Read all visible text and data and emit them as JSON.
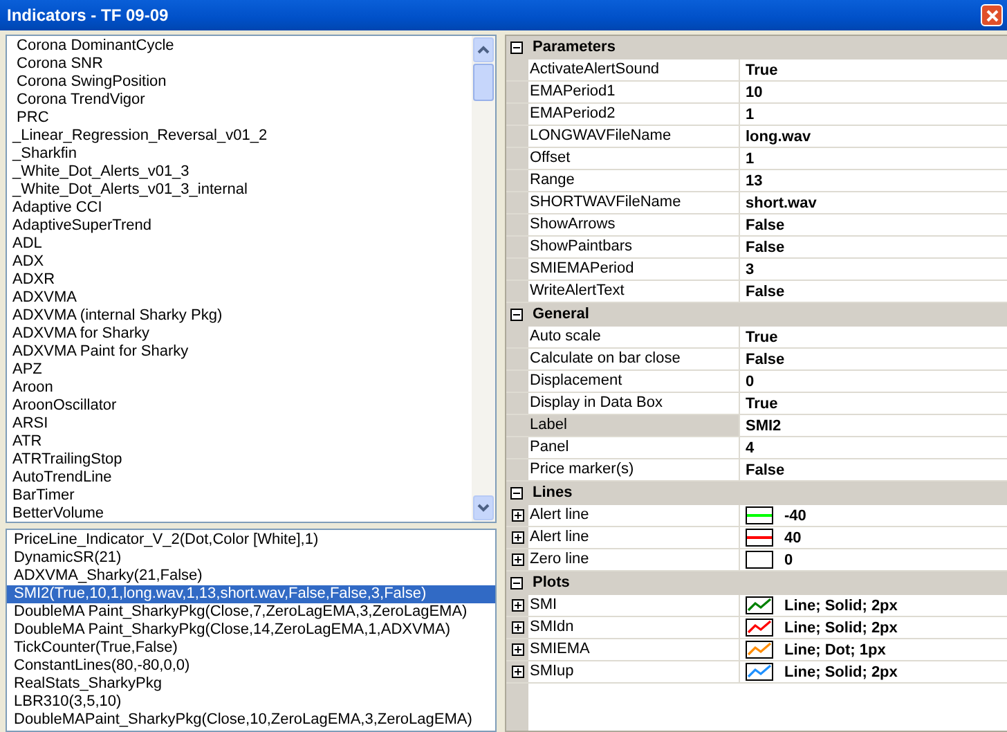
{
  "window": {
    "title": "Indicators - TF 09-09"
  },
  "available_indicators": [
    {
      "label": " Corona DominantCycle",
      "selected": false
    },
    {
      "label": " Corona SNR",
      "selected": false
    },
    {
      "label": " Corona SwingPosition",
      "selected": false
    },
    {
      "label": " Corona TrendVigor",
      "selected": false
    },
    {
      "label": " PRC",
      "selected": false
    },
    {
      "label": "_Linear_Regression_Reversal_v01_2",
      "selected": false
    },
    {
      "label": "_Sharkfin",
      "selected": false
    },
    {
      "label": "_White_Dot_Alerts_v01_3",
      "selected": false
    },
    {
      "label": "_White_Dot_Alerts_v01_3_internal",
      "selected": false
    },
    {
      "label": "Adaptive CCI",
      "selected": false
    },
    {
      "label": "AdaptiveSuperTrend",
      "selected": false
    },
    {
      "label": "ADL",
      "selected": false
    },
    {
      "label": "ADX",
      "selected": false
    },
    {
      "label": "ADXR",
      "selected": false
    },
    {
      "label": "ADXVMA",
      "selected": false
    },
    {
      "label": "ADXVMA (internal Sharky Pkg)",
      "selected": false
    },
    {
      "label": "ADXVMA for Sharky",
      "selected": false
    },
    {
      "label": "ADXVMA Paint for Sharky",
      "selected": false
    },
    {
      "label": "APZ",
      "selected": false
    },
    {
      "label": "Aroon",
      "selected": false
    },
    {
      "label": "AroonOscillator",
      "selected": false
    },
    {
      "label": "ARSI",
      "selected": false
    },
    {
      "label": "ATR",
      "selected": false
    },
    {
      "label": "ATRTrailingStop",
      "selected": false
    },
    {
      "label": "AutoTrendLine",
      "selected": false
    },
    {
      "label": "BarTimer",
      "selected": false
    },
    {
      "label": "BetterVolume",
      "selected": false
    }
  ],
  "applied_indicators": [
    {
      "label": "PriceLine_Indicator_V_2(Dot,Color [White],1)",
      "selected": false
    },
    {
      "label": "DynamicSR(21)",
      "selected": false
    },
    {
      "label": "ADXVMA_Sharky(21,False)",
      "selected": false
    },
    {
      "label": "SMI2(True,10,1,long.wav,1,13,short.wav,False,False,3,False)",
      "selected": true
    },
    {
      "label": "DoubleMA Paint_SharkyPkg(Close,7,ZeroLagEMA,3,ZeroLagEMA)",
      "selected": false
    },
    {
      "label": "DoubleMA Paint_SharkyPkg(Close,14,ZeroLagEMA,1,ADXVMA)",
      "selected": false
    },
    {
      "label": "TickCounter(True,False)",
      "selected": false
    },
    {
      "label": "ConstantLines(80,-80,0,0)",
      "selected": false
    },
    {
      "label": "RealStats_SharkyPkg",
      "selected": false
    },
    {
      "label": "LBR310(3,5,10)",
      "selected": false
    },
    {
      "label": "DoubleMAPaint_SharkyPkg(Close,10,ZeroLagEMA,3,ZeroLagEMA)",
      "selected": false
    }
  ],
  "property_grid": [
    {
      "category": "Parameters",
      "expanded": true,
      "properties": [
        {
          "kind": "value",
          "name": "ActivateAlertSound",
          "value": "True",
          "selected": false
        },
        {
          "kind": "value",
          "name": "EMAPeriod1",
          "value": "10",
          "selected": false
        },
        {
          "kind": "value",
          "name": "EMAPeriod2",
          "value": "1",
          "selected": false
        },
        {
          "kind": "value",
          "name": "LONGWAVFileName",
          "value": "long.wav",
          "selected": false
        },
        {
          "kind": "value",
          "name": "Offset",
          "value": "1",
          "selected": false
        },
        {
          "kind": "value",
          "name": "Range",
          "value": "13",
          "selected": false
        },
        {
          "kind": "value",
          "name": "SHORTWAVFileName",
          "value": "short.wav",
          "selected": false
        },
        {
          "kind": "value",
          "name": "ShowArrows",
          "value": "False",
          "selected": false
        },
        {
          "kind": "value",
          "name": "ShowPaintbars",
          "value": "False",
          "selected": false
        },
        {
          "kind": "value",
          "name": "SMIEMAPeriod",
          "value": "3",
          "selected": false
        },
        {
          "kind": "value",
          "name": "WriteAlertText",
          "value": "False",
          "selected": false
        }
      ]
    },
    {
      "category": "General",
      "expanded": true,
      "properties": [
        {
          "kind": "value",
          "name": "Auto scale",
          "value": "True",
          "selected": false
        },
        {
          "kind": "value",
          "name": "Calculate on bar close",
          "value": "False",
          "selected": false
        },
        {
          "kind": "value",
          "name": "Displacement",
          "value": "0",
          "selected": false
        },
        {
          "kind": "value",
          "name": "Display in Data Box",
          "value": "True",
          "selected": false
        },
        {
          "kind": "value",
          "name": "Label",
          "value": "SMI2",
          "selected": true
        },
        {
          "kind": "value",
          "name": "Panel",
          "value": "4",
          "selected": false
        },
        {
          "kind": "value",
          "name": "Price marker(s)",
          "value": "False",
          "selected": false
        }
      ]
    },
    {
      "category": "Lines",
      "expanded": true,
      "properties": [
        {
          "kind": "line",
          "name": "Alert line",
          "value": "-40",
          "color": "#00ff00",
          "expanded": false,
          "selected": false
        },
        {
          "kind": "line",
          "name": "Alert line",
          "value": "40",
          "color": "#ff0000",
          "expanded": false,
          "selected": false
        },
        {
          "kind": "line",
          "name": "Zero line",
          "value": "0",
          "expanded": false,
          "selected": false
        }
      ]
    },
    {
      "category": "Plots",
      "expanded": true,
      "properties": [
        {
          "kind": "plot",
          "name": "SMI",
          "value": "Line; Solid; 2px",
          "color": "#008000",
          "expanded": false,
          "selected": false
        },
        {
          "kind": "plot",
          "name": "SMIdn",
          "value": "Line; Solid; 2px",
          "color": "#ff0000",
          "expanded": false,
          "selected": false
        },
        {
          "kind": "plot",
          "name": "SMIEMA",
          "value": "Line; Dot; 1px",
          "color": "#ff8c00",
          "expanded": false,
          "selected": false
        },
        {
          "kind": "plot",
          "name": "SMIup",
          "value": "Line; Solid; 2px",
          "color": "#1e90ff",
          "expanded": false,
          "selected": false
        }
      ]
    }
  ]
}
